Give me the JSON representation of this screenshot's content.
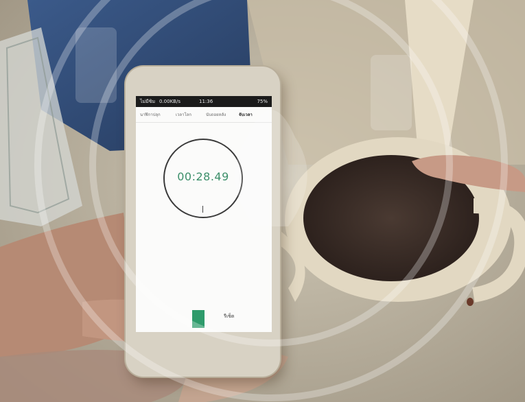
{
  "status_bar": {
    "carrier": "ไม่มีซิม",
    "network": "0.00KB/s",
    "time": "11:36",
    "battery": "75%"
  },
  "tabs": [
    {
      "label": "นาฬิกาปลุก"
    },
    {
      "label": "เวลาโลก"
    },
    {
      "label": "นับถอยหลัง"
    },
    {
      "label": "จับเวลา"
    }
  ],
  "stopwatch": {
    "time": "00:28.49"
  },
  "controls": {
    "reset_label": "รีเซ็ต"
  },
  "colors": {
    "timer_text": "#3c8f6a",
    "start_button": "#2e9b6b",
    "mug": "#e2d8c2",
    "coffee": "#3a2b25"
  }
}
